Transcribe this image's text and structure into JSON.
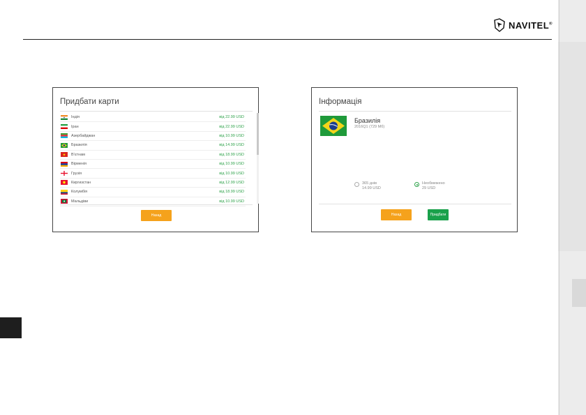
{
  "brand": {
    "name": "NAVITEL",
    "reg": "®"
  },
  "left_panel": {
    "title": "Придбати карти",
    "back_button": "Назад",
    "countries": [
      {
        "name": "Індія",
        "price": "від 22.99 USD",
        "flag": "india"
      },
      {
        "name": "Іран",
        "price": "від 22.99 USD",
        "flag": "iran"
      },
      {
        "name": "Азербайджан",
        "price": "від 10.99 USD",
        "flag": "azerbaijan"
      },
      {
        "name": "Бразилія",
        "price": "від 14.99 USD",
        "flag": "brazil"
      },
      {
        "name": "В'єтнам",
        "price": "від 18.99 USD",
        "flag": "vietnam"
      },
      {
        "name": "Вірменія",
        "price": "від 10.99 USD",
        "flag": "armenia"
      },
      {
        "name": "Грузія",
        "price": "від 10.99 USD",
        "flag": "georgia"
      },
      {
        "name": "Киргизстан",
        "price": "від 12.99 USD",
        "flag": "kyrgyzstan"
      },
      {
        "name": "Колумбія",
        "price": "від 18.99 USD",
        "flag": "colombia"
      },
      {
        "name": "Мальдіви",
        "price": "від 10.99 USD",
        "flag": "maldives"
      }
    ]
  },
  "right_panel": {
    "title": "Інформація",
    "map_name": "Бразилія",
    "map_meta": "2016Q1 (729 Мб)",
    "options": [
      {
        "line1": "365 днів",
        "line2": "14.99 USD",
        "checked": false
      },
      {
        "line1": "Необмежено",
        "line2": "29 USD",
        "checked": true
      }
    ],
    "back_button": "Назад",
    "buy_button": "Придбати"
  },
  "colors": {
    "price_green": "#2ea24a",
    "orange_button": "#f5a21c",
    "green_button": "#1aa14b"
  }
}
